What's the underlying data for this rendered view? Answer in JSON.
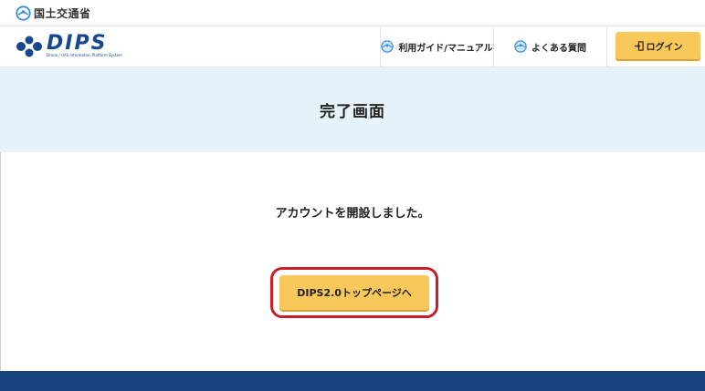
{
  "gov": {
    "name": "国土交通省"
  },
  "brand": {
    "name": "DIPS",
    "subtitle": "Drone / UAS Information Platform System"
  },
  "nav": {
    "guide_label": "利用ガイド/マニュアル",
    "faq_label": "よくある質問",
    "login_label": "ログイン"
  },
  "page": {
    "title": "完了画面",
    "message": "アカウントを開設しました。",
    "top_button_label": "DIPS2.0トップページへ"
  },
  "colors": {
    "brand_blue": "#17478d",
    "button_yellow": "#f8c95a",
    "title_band": "#e7f3fb",
    "highlight_red": "#c81e28",
    "footer_navy": "#17437f"
  },
  "icons": {
    "gov_logo": "mlit-logo-icon",
    "brand_mark": "dips-logo-icon",
    "guide": "globe-icon",
    "faq": "globe-icon",
    "login": "login-door-icon"
  }
}
